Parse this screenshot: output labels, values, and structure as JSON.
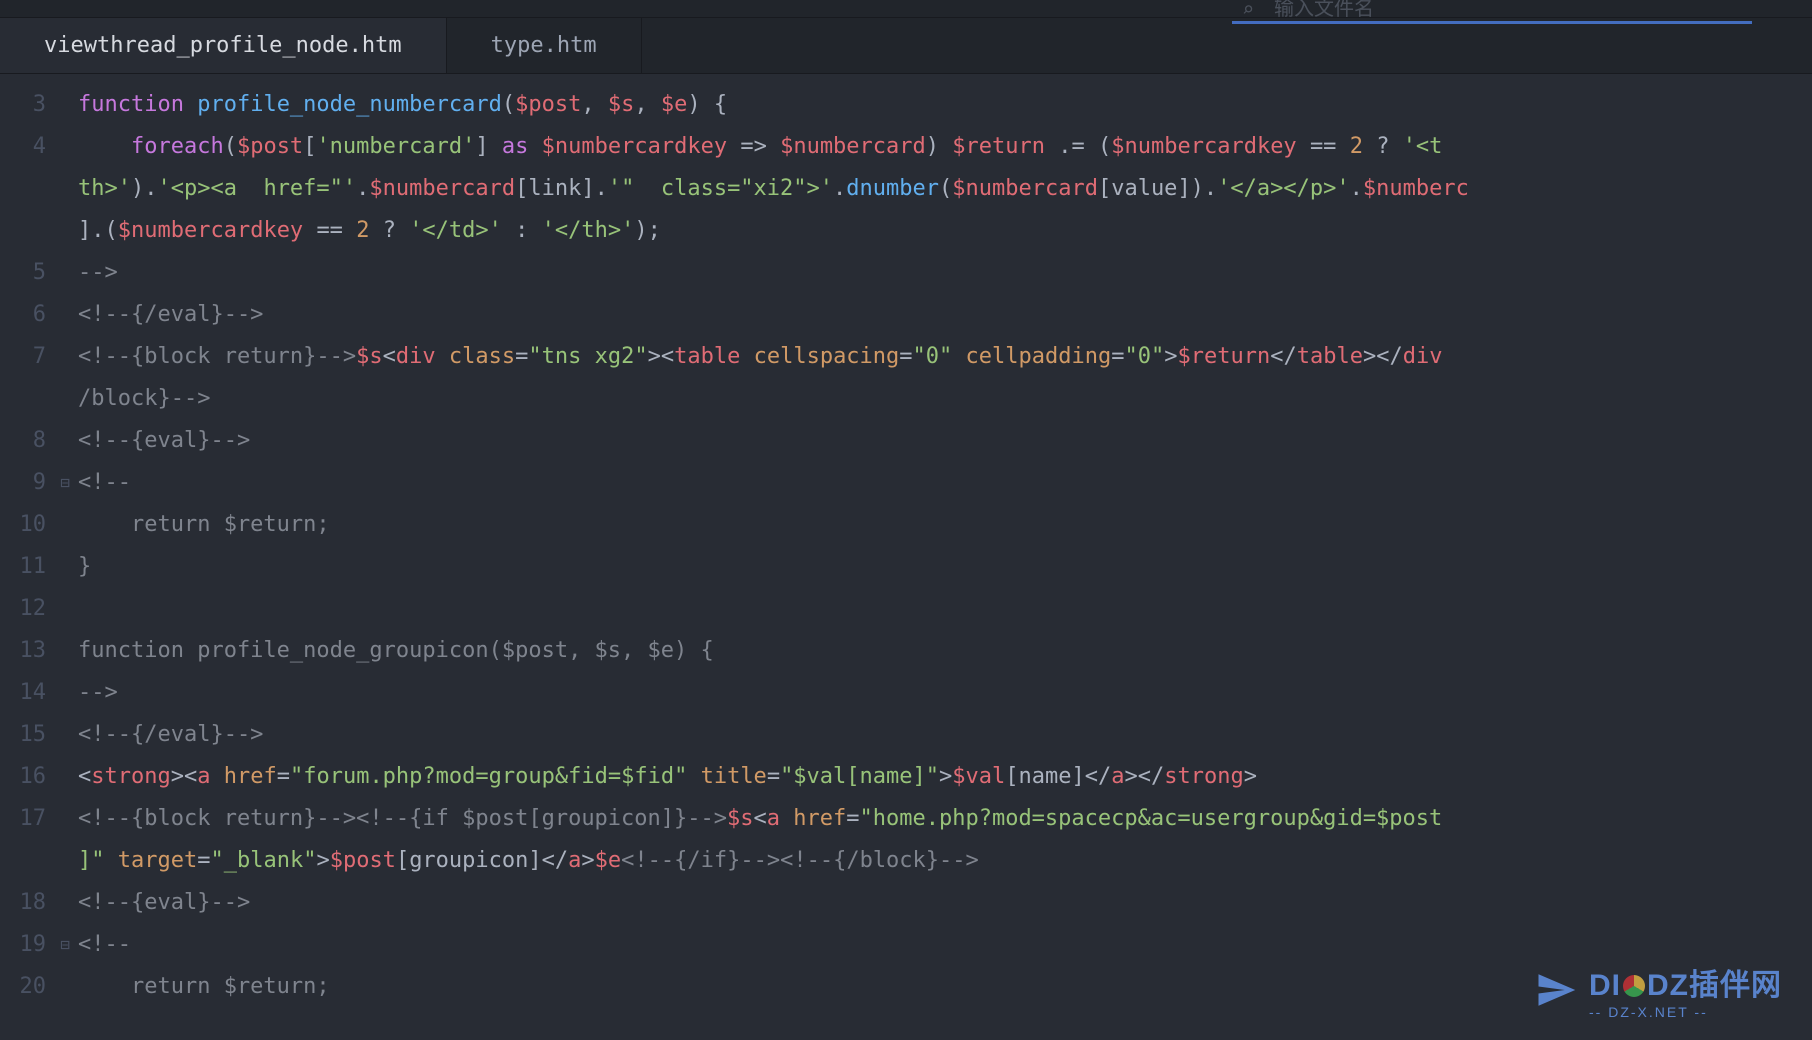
{
  "topbar": {
    "search_placeholder": "输入文件名"
  },
  "tabs": [
    {
      "label": "viewthread_profile_node.htm",
      "active": true
    },
    {
      "label": "type.htm",
      "active": false
    }
  ],
  "gutter_start": 3,
  "gutter_end": 20,
  "fold_lines": [
    9,
    19
  ],
  "code_lines": [
    {
      "ln": 3,
      "segments": [
        {
          "cls": "c-kw",
          "t": "function"
        },
        {
          "cls": "c-plain",
          "t": " "
        },
        {
          "cls": "c-func",
          "t": "profile_node_numbercard"
        },
        {
          "cls": "c-punct",
          "t": "("
        },
        {
          "cls": "c-var",
          "t": "$post"
        },
        {
          "cls": "c-punct",
          "t": ", "
        },
        {
          "cls": "c-var",
          "t": "$s"
        },
        {
          "cls": "c-punct",
          "t": ", "
        },
        {
          "cls": "c-var",
          "t": "$e"
        },
        {
          "cls": "c-punct",
          "t": ") {"
        }
      ]
    },
    {
      "ln": 4,
      "segments": [
        {
          "cls": "c-plain",
          "t": "    "
        },
        {
          "cls": "c-kw",
          "t": "foreach"
        },
        {
          "cls": "c-punct",
          "t": "("
        },
        {
          "cls": "c-var",
          "t": "$post"
        },
        {
          "cls": "c-punct",
          "t": "["
        },
        {
          "cls": "c-str",
          "t": "'numbercard'"
        },
        {
          "cls": "c-punct",
          "t": "] "
        },
        {
          "cls": "c-kw",
          "t": "as"
        },
        {
          "cls": "c-plain",
          "t": " "
        },
        {
          "cls": "c-var",
          "t": "$numbercardkey"
        },
        {
          "cls": "c-plain",
          "t": " "
        },
        {
          "cls": "c-op",
          "t": "=>"
        },
        {
          "cls": "c-plain",
          "t": " "
        },
        {
          "cls": "c-var",
          "t": "$numbercard"
        },
        {
          "cls": "c-punct",
          "t": ") "
        },
        {
          "cls": "c-var",
          "t": "$return"
        },
        {
          "cls": "c-plain",
          "t": " "
        },
        {
          "cls": "c-op",
          "t": ".="
        },
        {
          "cls": "c-plain",
          "t": " ("
        },
        {
          "cls": "c-var",
          "t": "$numbercardkey"
        },
        {
          "cls": "c-plain",
          "t": " "
        },
        {
          "cls": "c-op",
          "t": "=="
        },
        {
          "cls": "c-plain",
          "t": " "
        },
        {
          "cls": "c-num",
          "t": "2"
        },
        {
          "cls": "c-plain",
          "t": " "
        },
        {
          "cls": "c-op",
          "t": "?"
        },
        {
          "cls": "c-plain",
          "t": " "
        },
        {
          "cls": "c-str",
          "t": "'<t"
        }
      ]
    },
    {
      "ln": "4w1",
      "wrap": true,
      "segments": [
        {
          "cls": "c-str",
          "t": "th>'"
        },
        {
          "cls": "c-punct",
          "t": ")."
        },
        {
          "cls": "c-str",
          "t": "'<p><a  href=\"'"
        },
        {
          "cls": "c-punct",
          "t": "."
        },
        {
          "cls": "c-var",
          "t": "$numbercard"
        },
        {
          "cls": "c-punct",
          "t": "["
        },
        {
          "cls": "c-plain",
          "t": "link"
        },
        {
          "cls": "c-punct",
          "t": "]."
        },
        {
          "cls": "c-str",
          "t": "'\"  class=\"xi2\">'"
        },
        {
          "cls": "c-punct",
          "t": "."
        },
        {
          "cls": "c-func",
          "t": "dnumber"
        },
        {
          "cls": "c-punct",
          "t": "("
        },
        {
          "cls": "c-var",
          "t": "$numbercard"
        },
        {
          "cls": "c-punct",
          "t": "["
        },
        {
          "cls": "c-plain",
          "t": "value"
        },
        {
          "cls": "c-punct",
          "t": "])."
        },
        {
          "cls": "c-str",
          "t": "'</a></p>'"
        },
        {
          "cls": "c-punct",
          "t": "."
        },
        {
          "cls": "c-var",
          "t": "$numberc"
        }
      ]
    },
    {
      "ln": "4w2",
      "wrap": true,
      "segments": [
        {
          "cls": "c-punct",
          "t": "].("
        },
        {
          "cls": "c-var",
          "t": "$numbercardkey"
        },
        {
          "cls": "c-plain",
          "t": " "
        },
        {
          "cls": "c-op",
          "t": "=="
        },
        {
          "cls": "c-plain",
          "t": " "
        },
        {
          "cls": "c-num",
          "t": "2"
        },
        {
          "cls": "c-plain",
          "t": " "
        },
        {
          "cls": "c-op",
          "t": "?"
        },
        {
          "cls": "c-plain",
          "t": " "
        },
        {
          "cls": "c-str",
          "t": "'</td>'"
        },
        {
          "cls": "c-plain",
          "t": " "
        },
        {
          "cls": "c-op",
          "t": ":"
        },
        {
          "cls": "c-plain",
          "t": " "
        },
        {
          "cls": "c-str",
          "t": "'</th>'"
        },
        {
          "cls": "c-punct",
          "t": ");"
        }
      ]
    },
    {
      "ln": 5,
      "segments": [
        {
          "cls": "c-comment",
          "t": "-->"
        }
      ]
    },
    {
      "ln": 6,
      "segments": [
        {
          "cls": "c-comment",
          "t": "<!--{/eval}-->"
        }
      ]
    },
    {
      "ln": 7,
      "segments": [
        {
          "cls": "c-comment",
          "t": "<!--{block return}-->"
        },
        {
          "cls": "c-var",
          "t": "$s"
        },
        {
          "cls": "c-punct",
          "t": "<"
        },
        {
          "cls": "c-tag",
          "t": "div"
        },
        {
          "cls": "c-plain",
          "t": " "
        },
        {
          "cls": "c-attr",
          "t": "class"
        },
        {
          "cls": "c-punct",
          "t": "="
        },
        {
          "cls": "c-str",
          "t": "\"tns xg2\""
        },
        {
          "cls": "c-punct",
          "t": "><"
        },
        {
          "cls": "c-tag",
          "t": "table"
        },
        {
          "cls": "c-plain",
          "t": " "
        },
        {
          "cls": "c-attr",
          "t": "cellspacing"
        },
        {
          "cls": "c-punct",
          "t": "="
        },
        {
          "cls": "c-str",
          "t": "\"0\""
        },
        {
          "cls": "c-plain",
          "t": " "
        },
        {
          "cls": "c-attr",
          "t": "cellpadding"
        },
        {
          "cls": "c-punct",
          "t": "="
        },
        {
          "cls": "c-str",
          "t": "\"0\""
        },
        {
          "cls": "c-punct",
          "t": ">"
        },
        {
          "cls": "c-var",
          "t": "$return"
        },
        {
          "cls": "c-punct",
          "t": "</"
        },
        {
          "cls": "c-tag",
          "t": "table"
        },
        {
          "cls": "c-punct",
          "t": "></"
        },
        {
          "cls": "c-tag",
          "t": "div"
        }
      ]
    },
    {
      "ln": "7w1",
      "wrap": true,
      "segments": [
        {
          "cls": "c-comment",
          "t": "/block}-->"
        }
      ]
    },
    {
      "ln": 8,
      "segments": [
        {
          "cls": "c-comment",
          "t": "<!--{eval}-->"
        }
      ]
    },
    {
      "ln": 9,
      "segments": [
        {
          "cls": "c-comment",
          "t": "<!--"
        }
      ]
    },
    {
      "ln": 10,
      "segments": [
        {
          "cls": "c-comment",
          "t": "    return $return;"
        }
      ]
    },
    {
      "ln": 11,
      "segments": [
        {
          "cls": "c-comment",
          "t": "}"
        }
      ]
    },
    {
      "ln": 12,
      "segments": [
        {
          "cls": "c-plain",
          "t": ""
        }
      ]
    },
    {
      "ln": 13,
      "segments": [
        {
          "cls": "c-comment",
          "t": "function profile_node_groupicon($post, $s, $e) {"
        }
      ]
    },
    {
      "ln": 14,
      "segments": [
        {
          "cls": "c-comment",
          "t": "-->"
        }
      ]
    },
    {
      "ln": 15,
      "segments": [
        {
          "cls": "c-comment",
          "t": "<!--{/eval}-->"
        }
      ]
    },
    {
      "ln": 16,
      "segments": [
        {
          "cls": "c-punct",
          "t": "<"
        },
        {
          "cls": "c-tag",
          "t": "strong"
        },
        {
          "cls": "c-punct",
          "t": "><"
        },
        {
          "cls": "c-tag",
          "t": "a"
        },
        {
          "cls": "c-plain",
          "t": " "
        },
        {
          "cls": "c-attr",
          "t": "href"
        },
        {
          "cls": "c-punct",
          "t": "="
        },
        {
          "cls": "c-str",
          "t": "\"forum.php?mod=group&fid=$fid\""
        },
        {
          "cls": "c-plain",
          "t": " "
        },
        {
          "cls": "c-attr",
          "t": "title"
        },
        {
          "cls": "c-punct",
          "t": "="
        },
        {
          "cls": "c-str",
          "t": "\"$val[name]\""
        },
        {
          "cls": "c-punct",
          "t": ">"
        },
        {
          "cls": "c-var",
          "t": "$val"
        },
        {
          "cls": "c-punct",
          "t": "["
        },
        {
          "cls": "c-plain",
          "t": "name"
        },
        {
          "cls": "c-punct",
          "t": "]</"
        },
        {
          "cls": "c-tag",
          "t": "a"
        },
        {
          "cls": "c-punct",
          "t": "></"
        },
        {
          "cls": "c-tag",
          "t": "strong"
        },
        {
          "cls": "c-punct",
          "t": ">"
        }
      ]
    },
    {
      "ln": 17,
      "segments": [
        {
          "cls": "c-comment",
          "t": "<!--{block return}--><!--{if $post[groupicon]}-->"
        },
        {
          "cls": "c-var",
          "t": "$s"
        },
        {
          "cls": "c-punct",
          "t": "<"
        },
        {
          "cls": "c-tag",
          "t": "a"
        },
        {
          "cls": "c-plain",
          "t": " "
        },
        {
          "cls": "c-attr",
          "t": "href"
        },
        {
          "cls": "c-punct",
          "t": "="
        },
        {
          "cls": "c-str",
          "t": "\"home.php?mod=spacecp&ac=usergroup&gid=$post"
        }
      ]
    },
    {
      "ln": "17w1",
      "wrap": true,
      "segments": [
        {
          "cls": "c-str",
          "t": "]\""
        },
        {
          "cls": "c-plain",
          "t": " "
        },
        {
          "cls": "c-attr",
          "t": "target"
        },
        {
          "cls": "c-punct",
          "t": "="
        },
        {
          "cls": "c-str",
          "t": "\"_blank\""
        },
        {
          "cls": "c-punct",
          "t": ">"
        },
        {
          "cls": "c-var",
          "t": "$post"
        },
        {
          "cls": "c-punct",
          "t": "["
        },
        {
          "cls": "c-plain",
          "t": "groupicon"
        },
        {
          "cls": "c-punct",
          "t": "]</"
        },
        {
          "cls": "c-tag",
          "t": "a"
        },
        {
          "cls": "c-punct",
          "t": ">"
        },
        {
          "cls": "c-var",
          "t": "$e"
        },
        {
          "cls": "c-comment",
          "t": "<!--{/if}--><!--{/block}-->"
        }
      ]
    },
    {
      "ln": 18,
      "segments": [
        {
          "cls": "c-comment",
          "t": "<!--{eval}-->"
        }
      ]
    },
    {
      "ln": 19,
      "segments": [
        {
          "cls": "c-comment",
          "t": "<!--"
        }
      ]
    },
    {
      "ln": 20,
      "segments": [
        {
          "cls": "c-comment",
          "t": "    return $return;"
        }
      ]
    }
  ],
  "watermark": {
    "brand_prefix": "DI",
    "brand_suffix": "DZ",
    "brand_cn": "插伴网",
    "sub": "-- DZ-X.NET --"
  }
}
